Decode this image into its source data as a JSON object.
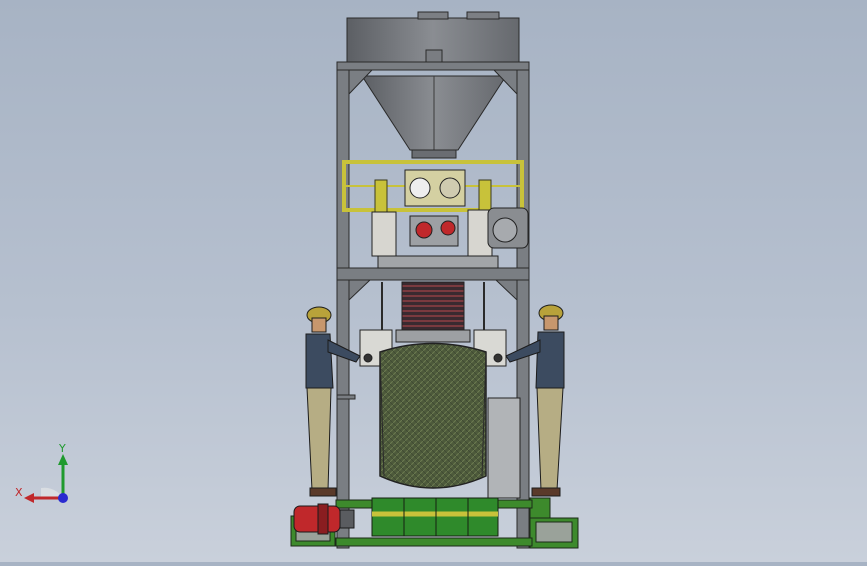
{
  "viewport": {
    "background_top": "#a7b3c4",
    "background_bottom": "#c9d0db"
  },
  "model": {
    "frame_color": "#707478",
    "hopper_color": "#6f7277",
    "yellow_frame_color": "#c8c23a",
    "green_base_color": "#3d8a2c",
    "bag_color": "#4b5a3c",
    "motor_color": "#c0282b"
  },
  "triad": {
    "x_label": "X",
    "y_label": "Y",
    "x_color": "#c0282b",
    "y_color": "#1f9a2e",
    "z_color": "#2a2ad0"
  }
}
